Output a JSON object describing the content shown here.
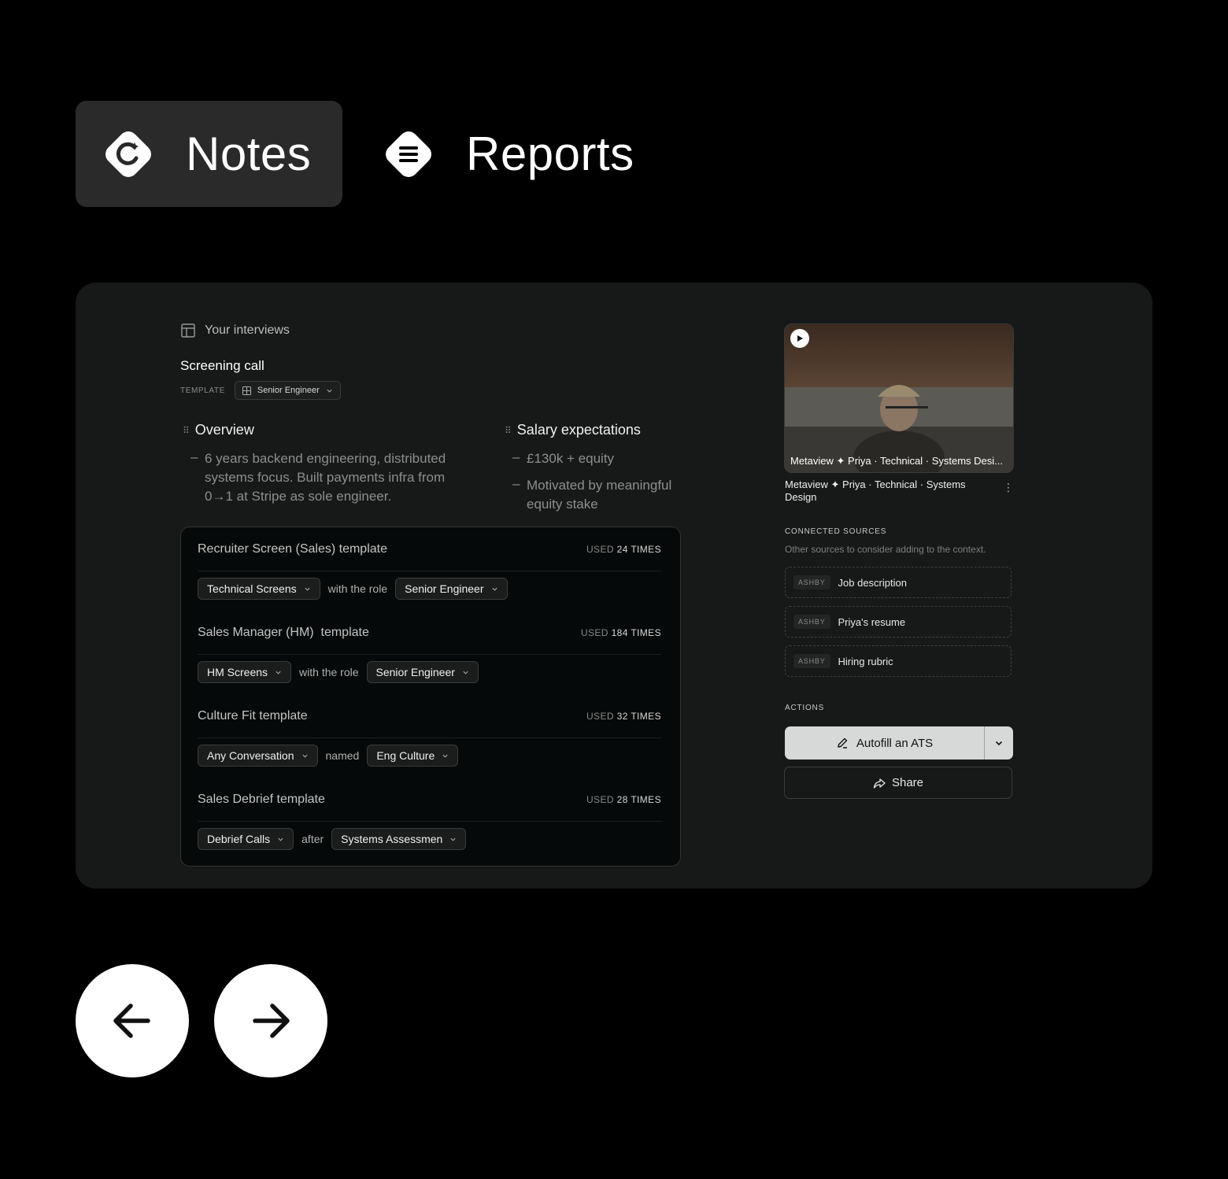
{
  "tabs": {
    "notes": {
      "label": "Notes",
      "icon": "notes-sparkle-icon",
      "active": true
    },
    "reports": {
      "label": "Reports",
      "icon": "list-icon",
      "active": false
    }
  },
  "interview": {
    "breadcrumb": "Your interviews",
    "title": "Screening call",
    "template_label": "TEMPLATE",
    "template_value": "Senior Engineer"
  },
  "notes": [
    {
      "heading": "Overview",
      "items": [
        "6 years backend engineering, distributed systems focus. Built payments infra from 0→1 at Stripe as sole engineer."
      ]
    },
    {
      "heading": "Salary expectations",
      "items": [
        "£130k + equity",
        "Motivated by meaningful equity stake"
      ]
    }
  ],
  "templates": [
    {
      "name": "Recruiter Screen (Sales) template",
      "used_prefix": "USED",
      "used_count": "24 TIMES",
      "rule": {
        "first": "Technical Screens",
        "connector": "with the role",
        "second": "Senior Engineer"
      }
    },
    {
      "name": "Sales Manager (HM)  template",
      "used_prefix": "USED",
      "used_count": "184 TIMES",
      "rule": {
        "first": "HM Screens",
        "connector": "with the role",
        "second": "Senior Engineer"
      }
    },
    {
      "name": "Culture Fit template",
      "used_prefix": "USED",
      "used_count": "32 TIMES",
      "rule": {
        "first": "Any Conversation",
        "connector": "named",
        "second": "Eng Culture"
      }
    },
    {
      "name": "Sales Debrief template",
      "used_prefix": "USED",
      "used_count": "28 TIMES",
      "rule": {
        "first": "Debrief Calls",
        "connector": "after",
        "second": "Systems Assessmen"
      }
    }
  ],
  "video": {
    "caption": "Metaview ✦ Priya · Technical · Systems Desi...",
    "title": "Metaview ✦ Priya · Technical · Systems Design"
  },
  "sources": {
    "label": "CONNECTED SOURCES",
    "subtitle": "Other sources to consider adding to the context.",
    "items": [
      {
        "badge": "ASHBY",
        "label": "Job description"
      },
      {
        "badge": "ASHBY",
        "label": "Priya's resume"
      },
      {
        "badge": "ASHBY",
        "label": "Hiring rubric"
      }
    ]
  },
  "actions": {
    "label": "ACTIONS",
    "autofill": "Autofill an ATS",
    "share": "Share"
  },
  "colors": {
    "background": "#000000",
    "panel": "#171918",
    "accent_button": "#d7d9d8"
  }
}
